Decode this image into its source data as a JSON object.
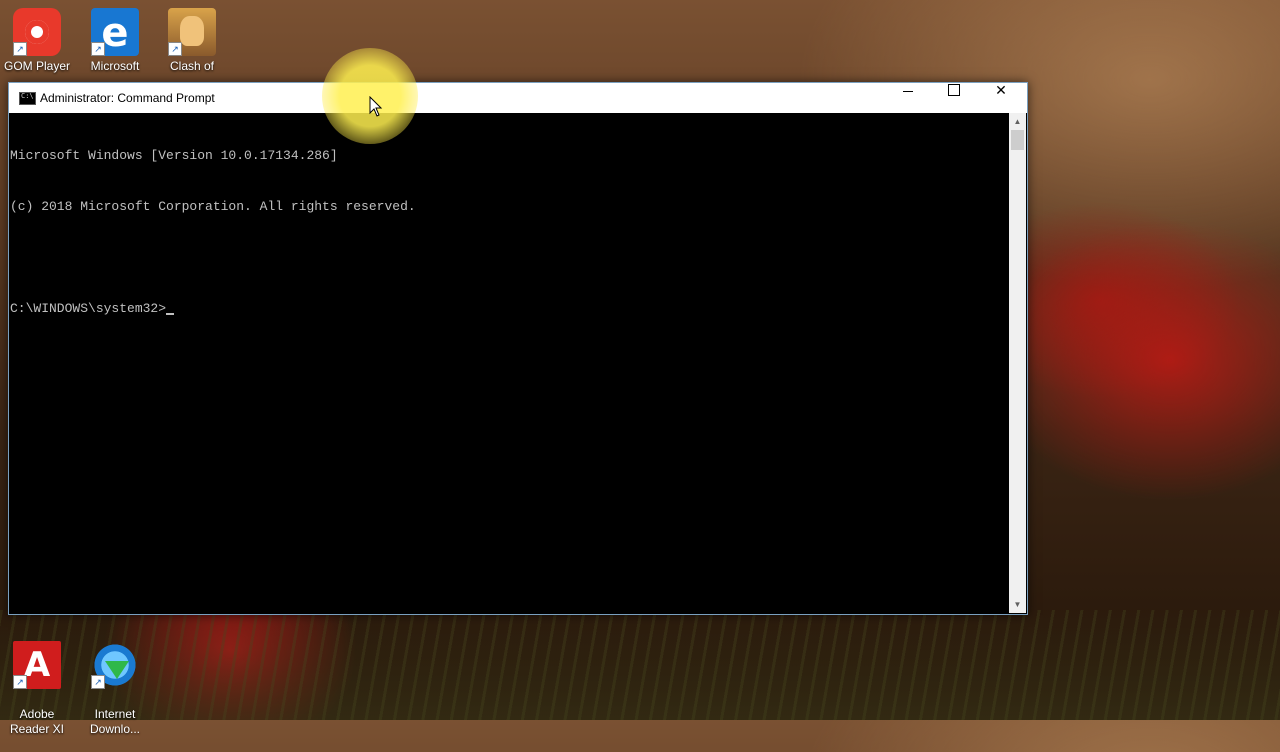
{
  "desktop": {
    "icons_top": [
      {
        "label": "GOM Player",
        "icon": "gom-player-icon"
      },
      {
        "label": "Microsoft",
        "icon": "edge-icon"
      },
      {
        "label": "Clash of",
        "icon": "clash-of-clans-icon"
      }
    ],
    "icons_bottom": [
      {
        "label": "Adobe\nReader XI",
        "icon": "adobe-reader-icon"
      },
      {
        "label": "Internet\nDownlo...",
        "icon": "internet-download-manager-icon"
      }
    ]
  },
  "window": {
    "title": "Administrator: Command Prompt",
    "controls": {
      "minimize": "–",
      "maximize": "□",
      "close": "✕"
    },
    "console_lines": [
      "Microsoft Windows [Version 10.0.17134.286]",
      "(c) 2018 Microsoft Corporation. All rights reserved.",
      "",
      "C:\\WINDOWS\\system32>"
    ]
  }
}
